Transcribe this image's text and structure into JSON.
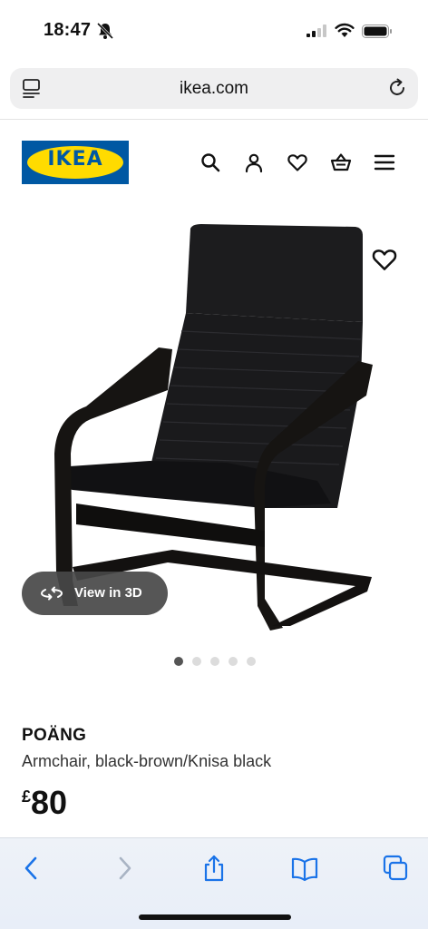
{
  "status_bar": {
    "time": "18:47"
  },
  "browser": {
    "url": "ikea.com"
  },
  "site": {
    "logo_text": "IKEA",
    "brand_blue": "#0058a3",
    "brand_yellow": "#ffdb00"
  },
  "header_icons": [
    "search-icon",
    "account-icon",
    "heart-icon",
    "basket-icon",
    "menu-icon"
  ],
  "product": {
    "view_3d_label": "View in 3D",
    "name": "POÄNG",
    "description": "Armchair, black-brown/Knisa black",
    "price_currency": "£",
    "price_value": "80",
    "carousel": {
      "total": 5,
      "active_index": 0
    }
  },
  "toolbar_icons": [
    "back-icon",
    "forward-icon",
    "share-icon",
    "bookmarks-icon",
    "tabs-icon"
  ],
  "colors": {
    "toolbar_blue": "#1a73e8"
  }
}
